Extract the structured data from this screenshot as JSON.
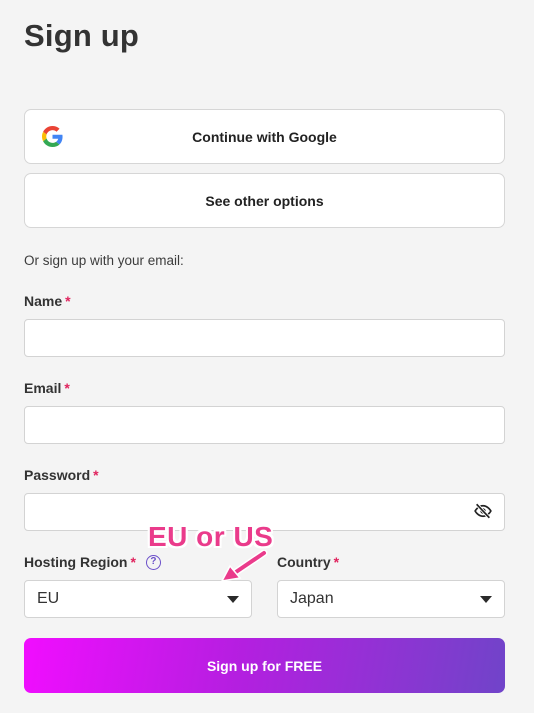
{
  "page": {
    "title": "Sign up"
  },
  "social": {
    "google_label": "Continue with Google",
    "other_label": "See other options"
  },
  "divider_text": "Or sign up with your email:",
  "form": {
    "name": {
      "label": "Name",
      "required_mark": "*",
      "value": ""
    },
    "email": {
      "label": "Email",
      "required_mark": "*",
      "value": ""
    },
    "password": {
      "label": "Password",
      "required_mark": "*",
      "value": ""
    },
    "hosting_region": {
      "label": "Hosting Region",
      "required_mark": "*",
      "help_icon": "?",
      "value": "EU"
    },
    "country": {
      "label": "Country",
      "required_mark": "*",
      "value": "Japan"
    }
  },
  "annotation": {
    "text": "EU or US",
    "color": "#ea3b8b"
  },
  "submit_label": "Sign up for FREE",
  "icons": {
    "google": "google-logo-icon",
    "password_toggle": "eye-slash-icon",
    "help": "question-circle-icon",
    "dropdown": "caret-down-icon"
  },
  "colors": {
    "required": "#e0245e",
    "help_icon": "#6b4fc9",
    "submit_gradient_start": "#f10dff",
    "submit_gradient_end": "#7044c9"
  }
}
